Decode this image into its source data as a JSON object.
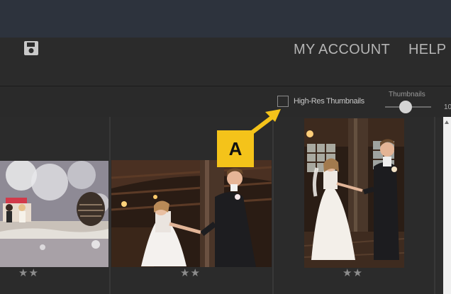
{
  "header": {
    "nav": {
      "account": "MY ACCOUNT",
      "help": "HELP"
    },
    "icons": {
      "save": "save-icon"
    }
  },
  "toolbar": {
    "hires_label": "High-Res Thumbnails",
    "hires_checked": false,
    "thumbnails_label": "Thumbnails",
    "slider_max_partial": "10"
  },
  "gallery": {
    "items": [
      {
        "subject": "cake-topper",
        "rating": "★★"
      },
      {
        "subject": "couple-dancing",
        "rating": "★★"
      },
      {
        "subject": "couple-portrait",
        "rating": "★★"
      }
    ]
  },
  "annotation": {
    "label": "A",
    "color": "#f4c31a"
  },
  "colors": {
    "topbar": "#2d333d",
    "background": "#2c2c2c",
    "accent": "#f4c31a"
  }
}
